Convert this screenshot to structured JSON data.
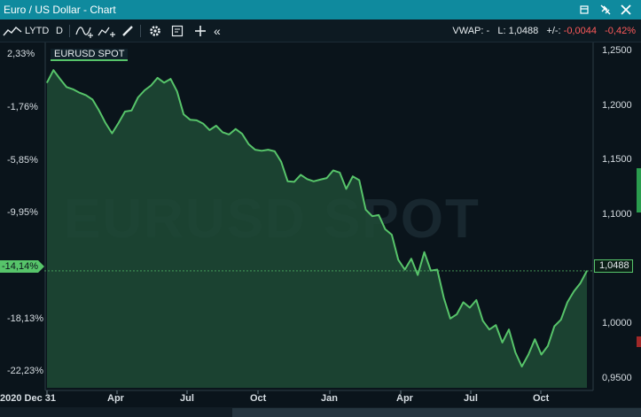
{
  "window": {
    "title": "Euro / US Dollar - Chart"
  },
  "toolbar": {
    "range": "LYTD",
    "interval": "D",
    "icons": [
      "trend-draw-icon",
      "compare-icon",
      "pencil-icon",
      "gear-icon",
      "note-icon",
      "crosshair-icon",
      "collapse-icon"
    ],
    "vwap_label": "VWAP: -",
    "last_label": "L: 1,0488",
    "change_label": "+/-:",
    "change_value": "-0,0044",
    "change_pct": "-0,42%"
  },
  "chart": {
    "instrument_tag": "EURUSD SPOT",
    "watermark": "EURUSD SPOT",
    "current_pct_label": "-14,14%",
    "current_price_label": "1,0488",
    "colors": {
      "line": "#57c46a",
      "fill": "#1f4a35",
      "accent": "#0f8a9e",
      "negative": "#ff5a5a"
    }
  },
  "chart_data": {
    "type": "area",
    "title": "",
    "series": [
      {
        "values": [
          1.2216,
          1.233,
          1.225,
          1.2175,
          1.2155,
          1.2123,
          1.21,
          1.206,
          1.196,
          1.1845,
          1.175,
          1.1845,
          1.195,
          1.196,
          1.208,
          1.2145,
          1.219,
          1.226,
          1.2215,
          1.225,
          1.2135,
          1.1925,
          1.1875,
          1.187,
          1.184,
          1.178,
          1.182,
          1.176,
          1.174,
          1.179,
          1.1745,
          1.165,
          1.16,
          1.159,
          1.16,
          1.1585,
          1.149,
          1.131,
          1.1305,
          1.137,
          1.133,
          1.131,
          1.1325,
          1.134,
          1.141,
          1.139,
          1.124,
          1.1355,
          1.132,
          1.105,
          1.099,
          1.1,
          1.087,
          1.082,
          1.059,
          1.05,
          1.06,
          1.045,
          1.066,
          1.049,
          1.05,
          1.024,
          1.005,
          1.009,
          1.02,
          1.015,
          1.022,
          1.003,
          0.995,
          0.999,
          0.983,
          0.995,
          0.974,
          0.961,
          0.972,
          0.986,
          0.972,
          0.98,
          0.998,
          1.004,
          1.02,
          1.03,
          1.0376,
          1.0488
        ]
      }
    ],
    "x_ticks": [
      "2020 Dec 31",
      "Apr",
      "Jul",
      "Oct",
      "Jan",
      "Apr",
      "Jul",
      "Oct"
    ],
    "y_left_ticks": [
      "2,33%",
      "-1,76%",
      "-5,85%",
      "-9,95%",
      "-14,14%",
      "-18,13%",
      "-22,23%"
    ],
    "y_right_ticks": [
      "1,2500",
      "1,2000",
      "1,1500",
      "1,1000",
      "1,0500",
      "1,0000",
      "0,9500"
    ],
    "ylim": [
      0.9415,
      1.2527
    ],
    "grid": false,
    "current_value": 1.0488
  }
}
